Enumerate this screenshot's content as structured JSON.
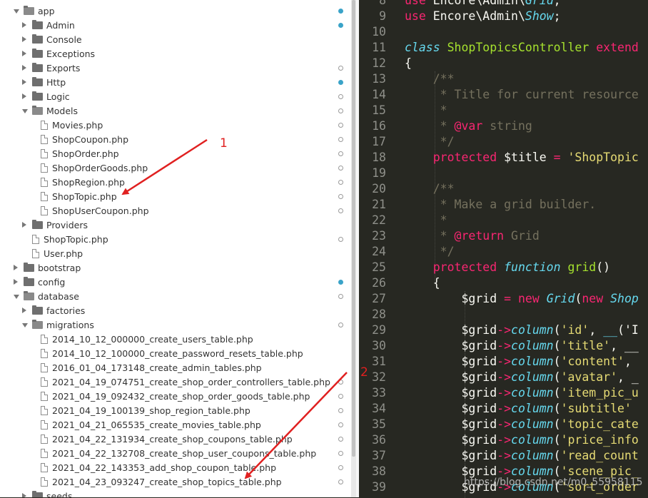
{
  "file_tree": [
    {
      "label": "app",
      "kind": "folder",
      "open": true,
      "indent": 0,
      "status": "dot"
    },
    {
      "label": "Admin",
      "kind": "folder",
      "open": false,
      "indent": 1,
      "status": "dot"
    },
    {
      "label": "Console",
      "kind": "folder",
      "open": false,
      "indent": 1,
      "status": "none"
    },
    {
      "label": "Exceptions",
      "kind": "folder",
      "open": false,
      "indent": 1,
      "status": "none"
    },
    {
      "label": "Exports",
      "kind": "folder",
      "open": false,
      "indent": 1,
      "status": "ring"
    },
    {
      "label": "Http",
      "kind": "folder",
      "open": false,
      "indent": 1,
      "status": "dot"
    },
    {
      "label": "Logic",
      "kind": "folder",
      "open": false,
      "indent": 1,
      "status": "ring"
    },
    {
      "label": "Models",
      "kind": "folder",
      "open": true,
      "indent": 1,
      "status": "ring"
    },
    {
      "label": "Movies.php",
      "kind": "file",
      "indent": 2,
      "status": "ring"
    },
    {
      "label": "ShopCoupon.php",
      "kind": "file",
      "indent": 2,
      "status": "ring"
    },
    {
      "label": "ShopOrder.php",
      "kind": "file",
      "indent": 2,
      "status": "ring"
    },
    {
      "label": "ShopOrderGoods.php",
      "kind": "file",
      "indent": 2,
      "status": "ring"
    },
    {
      "label": "ShopRegion.php",
      "kind": "file",
      "indent": 2,
      "status": "ring"
    },
    {
      "label": "ShopTopic.php",
      "kind": "file",
      "indent": 2,
      "status": "ring"
    },
    {
      "label": "ShopUserCoupon.php",
      "kind": "file",
      "indent": 2,
      "status": "ring"
    },
    {
      "label": "Providers",
      "kind": "folder",
      "open": false,
      "indent": 1,
      "status": "none"
    },
    {
      "label": "ShopTopic.php",
      "kind": "file",
      "indent": 1,
      "status": "ring"
    },
    {
      "label": "User.php",
      "kind": "file",
      "indent": 1,
      "status": "none"
    },
    {
      "label": "bootstrap",
      "kind": "folder",
      "open": false,
      "indent": 0,
      "status": "none"
    },
    {
      "label": "config",
      "kind": "folder",
      "open": false,
      "indent": 0,
      "status": "dot"
    },
    {
      "label": "database",
      "kind": "folder",
      "open": true,
      "indent": 0,
      "status": "ring"
    },
    {
      "label": "factories",
      "kind": "folder",
      "open": false,
      "indent": 1,
      "status": "none"
    },
    {
      "label": "migrations",
      "kind": "folder",
      "open": true,
      "indent": 1,
      "status": "ring"
    },
    {
      "label": "2014_10_12_000000_create_users_table.php",
      "kind": "file",
      "indent": 2,
      "status": "none"
    },
    {
      "label": "2014_10_12_100000_create_password_resets_table.php",
      "kind": "file",
      "indent": 2,
      "status": "none"
    },
    {
      "label": "2016_01_04_173148_create_admin_tables.php",
      "kind": "file",
      "indent": 2,
      "status": "none"
    },
    {
      "label": "2021_04_19_074751_create_shop_order_controllers_table.php",
      "kind": "file",
      "indent": 2,
      "status": "ring"
    },
    {
      "label": "2021_04_19_092432_create_shop_order_goods_table.php",
      "kind": "file",
      "indent": 2,
      "status": "ring"
    },
    {
      "label": "2021_04_19_100139_shop_region_table.php",
      "kind": "file",
      "indent": 2,
      "status": "ring"
    },
    {
      "label": "2021_04_21_065535_create_movies_table.php",
      "kind": "file",
      "indent": 2,
      "status": "ring"
    },
    {
      "label": "2021_04_22_131934_create_shop_coupons_table.php",
      "kind": "file",
      "indent": 2,
      "status": "ring"
    },
    {
      "label": "2021_04_22_132708_create_shop_user_coupons_table.php",
      "kind": "file",
      "indent": 2,
      "status": "ring"
    },
    {
      "label": "2021_04_22_143353_add_shop_coupon_table.php",
      "kind": "file",
      "indent": 2,
      "status": "ring"
    },
    {
      "label": "2021_04_23_093247_create_shop_topics_table.php",
      "kind": "file",
      "indent": 2,
      "status": "ring"
    },
    {
      "label": "seeds",
      "kind": "folder",
      "open": false,
      "indent": 1,
      "status": "none"
    }
  ],
  "annotations": {
    "first": "1",
    "second": "2"
  },
  "watermark": "https://blog.csdn.net/m0_55958115",
  "code_lines": [
    {
      "num": "8",
      "tokens": [
        [
          "kw",
          "use "
        ],
        [
          "",
          "Encore\\Admin\\"
        ],
        [
          "it",
          "Grid"
        ],
        [
          "",
          ";"
        ]
      ]
    },
    {
      "num": "9",
      "tokens": [
        [
          "kw",
          "use "
        ],
        [
          "",
          "Encore\\Admin\\"
        ],
        [
          "it",
          "Show"
        ],
        [
          "",
          ";"
        ]
      ]
    },
    {
      "num": "10",
      "tokens": []
    },
    {
      "num": "11",
      "tokens": [
        [
          "it",
          "class "
        ],
        [
          "fn",
          "ShopTopicsController "
        ],
        [
          "kw",
          "extend"
        ]
      ]
    },
    {
      "num": "12",
      "tokens": [
        [
          "",
          "{"
        ]
      ]
    },
    {
      "num": "13",
      "tokens": [
        [
          "cm",
          "    /**"
        ]
      ]
    },
    {
      "num": "14",
      "tokens": [
        [
          "cm",
          "     * Title for current resource"
        ]
      ]
    },
    {
      "num": "15",
      "tokens": [
        [
          "cm",
          "     *"
        ]
      ]
    },
    {
      "num": "16",
      "tokens": [
        [
          "cm",
          "     * "
        ],
        [
          "tag",
          "@var"
        ],
        [
          "cm",
          " string"
        ]
      ]
    },
    {
      "num": "17",
      "tokens": [
        [
          "cm",
          "     */"
        ]
      ]
    },
    {
      "num": "18",
      "tokens": [
        [
          "kw",
          "    protected "
        ],
        [
          "",
          "$title "
        ],
        [
          "kw",
          "= "
        ],
        [
          "str",
          "'ShopTopic"
        ]
      ]
    },
    {
      "num": "19",
      "tokens": []
    },
    {
      "num": "20",
      "tokens": [
        [
          "cm",
          "    /**"
        ]
      ]
    },
    {
      "num": "21",
      "tokens": [
        [
          "cm",
          "     * Make a grid builder."
        ]
      ]
    },
    {
      "num": "22",
      "tokens": [
        [
          "cm",
          "     *"
        ]
      ]
    },
    {
      "num": "23",
      "tokens": [
        [
          "cm",
          "     * "
        ],
        [
          "tag",
          "@return"
        ],
        [
          "cm",
          " Grid"
        ]
      ]
    },
    {
      "num": "24",
      "tokens": [
        [
          "cm",
          "     */"
        ]
      ]
    },
    {
      "num": "25",
      "tokens": [
        [
          "kw",
          "    protected "
        ],
        [
          "it",
          "function "
        ],
        [
          "fn",
          "grid"
        ],
        [
          "",
          "()"
        ]
      ]
    },
    {
      "num": "26",
      "tokens": [
        [
          "",
          "    {"
        ]
      ]
    },
    {
      "num": "27",
      "tokens": [
        [
          "",
          "        $grid "
        ],
        [
          "kw",
          "= new "
        ],
        [
          "it",
          "Grid"
        ],
        [
          "",
          "("
        ],
        [
          "kw",
          "new "
        ],
        [
          "it",
          "Shop"
        ]
      ]
    },
    {
      "num": "28",
      "tokens": []
    },
    {
      "num": "29",
      "tokens": [
        [
          "",
          "        $grid"
        ],
        [
          "kw",
          "->"
        ],
        [
          "it",
          "column"
        ],
        [
          "",
          "("
        ],
        [
          "str",
          "'id'"
        ],
        [
          "",
          ", "
        ],
        [
          "it",
          "__"
        ],
        [
          "",
          "('I"
        ]
      ]
    },
    {
      "num": "30",
      "tokens": [
        [
          "",
          "        $grid"
        ],
        [
          "kw",
          "->"
        ],
        [
          "it",
          "column"
        ],
        [
          "",
          "("
        ],
        [
          "str",
          "'title'"
        ],
        [
          "",
          ", __"
        ]
      ]
    },
    {
      "num": "31",
      "tokens": [
        [
          "",
          "        $grid"
        ],
        [
          "kw",
          "->"
        ],
        [
          "it",
          "column"
        ],
        [
          "",
          "("
        ],
        [
          "str",
          "'content'"
        ],
        [
          "",
          ","
        ]
      ]
    },
    {
      "num": "32",
      "tokens": [
        [
          "",
          "        $grid"
        ],
        [
          "kw",
          "->"
        ],
        [
          "it",
          "column"
        ],
        [
          "",
          "("
        ],
        [
          "str",
          "'avatar'"
        ],
        [
          "",
          ", _"
        ]
      ]
    },
    {
      "num": "33",
      "tokens": [
        [
          "",
          "        $grid"
        ],
        [
          "kw",
          "->"
        ],
        [
          "it",
          "column"
        ],
        [
          "",
          "("
        ],
        [
          "str",
          "'item_pic_u"
        ]
      ]
    },
    {
      "num": "34",
      "tokens": [
        [
          "",
          "        $grid"
        ],
        [
          "kw",
          "->"
        ],
        [
          "it",
          "column"
        ],
        [
          "",
          "("
        ],
        [
          "str",
          "'subtitle'"
        ]
      ]
    },
    {
      "num": "35",
      "tokens": [
        [
          "",
          "        $grid"
        ],
        [
          "kw",
          "->"
        ],
        [
          "it",
          "column"
        ],
        [
          "",
          "("
        ],
        [
          "str",
          "'topic_cate"
        ]
      ]
    },
    {
      "num": "36",
      "tokens": [
        [
          "",
          "        $grid"
        ],
        [
          "kw",
          "->"
        ],
        [
          "it",
          "column"
        ],
        [
          "",
          "("
        ],
        [
          "str",
          "'price_info"
        ]
      ]
    },
    {
      "num": "37",
      "tokens": [
        [
          "",
          "        $grid"
        ],
        [
          "kw",
          "->"
        ],
        [
          "it",
          "column"
        ],
        [
          "",
          "("
        ],
        [
          "str",
          "'read_count"
        ]
      ]
    },
    {
      "num": "38",
      "tokens": [
        [
          "",
          "        $grid"
        ],
        [
          "kw",
          "->"
        ],
        [
          "it",
          "column"
        ],
        [
          "",
          "("
        ],
        [
          "str",
          "'scene_pic_"
        ]
      ]
    },
    {
      "num": "39",
      "tokens": [
        [
          "",
          "        $grid"
        ],
        [
          "kw",
          "->"
        ],
        [
          "it",
          "column"
        ],
        [
          "",
          "("
        ],
        [
          "str",
          "'sort_order"
        ]
      ]
    }
  ]
}
